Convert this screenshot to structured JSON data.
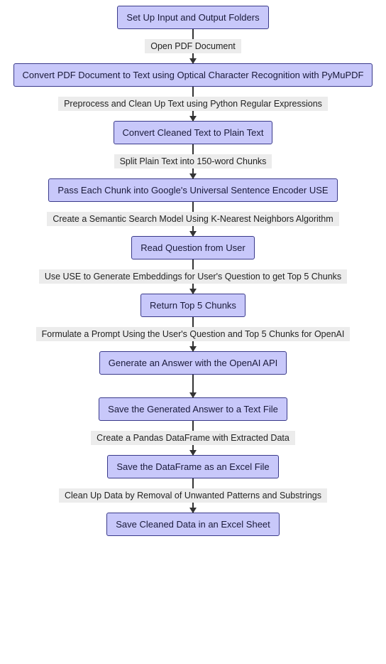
{
  "chart_data": {
    "type": "flowchart",
    "direction": "top-down",
    "nodes": [
      {
        "id": "n1",
        "label": "Set Up Input and Output Folders"
      },
      {
        "id": "n2",
        "label": "Convert PDF Document to Text using Optical Character Recognition with PyMuPDF"
      },
      {
        "id": "n3",
        "label": "Convert Cleaned Text to Plain Text"
      },
      {
        "id": "n4",
        "label": "Pass Each Chunk into Google's Universal Sentence Encoder USE"
      },
      {
        "id": "n5",
        "label": "Read Question from User"
      },
      {
        "id": "n6",
        "label": "Return Top 5 Chunks"
      },
      {
        "id": "n7",
        "label": "Generate an Answer with the OpenAI API"
      },
      {
        "id": "n8",
        "label": "Save the Generated Answer to a Text File"
      },
      {
        "id": "n9",
        "label": "Save the DataFrame as an Excel File"
      },
      {
        "id": "n10",
        "label": "Save Cleaned Data in an Excel Sheet"
      }
    ],
    "edges": [
      {
        "from": "n1",
        "to": "n2",
        "label": "Open PDF Document"
      },
      {
        "from": "n2",
        "to": "n3",
        "label": "Preprocess and Clean Up Text using Python Regular Expressions"
      },
      {
        "from": "n3",
        "to": "n4",
        "label": "Split Plain Text into 150-word Chunks"
      },
      {
        "from": "n4",
        "to": "n5",
        "label": "Create a Semantic Search Model Using K-Nearest Neighbors Algorithm"
      },
      {
        "from": "n5",
        "to": "n6",
        "label": "Use USE to Generate Embeddings for User's Question to get Top 5 Chunks"
      },
      {
        "from": "n6",
        "to": "n7",
        "label": "Formulate a Prompt Using the User's Question and Top 5 Chunks for OpenAI"
      },
      {
        "from": "n7",
        "to": "n8",
        "label": ""
      },
      {
        "from": "n8",
        "to": "n9",
        "label": "Create a Pandas DataFrame with Extracted Data"
      },
      {
        "from": "n9",
        "to": "n10",
        "label": "Clean Up Data by Removal of Unwanted Patterns and Substrings"
      }
    ]
  }
}
